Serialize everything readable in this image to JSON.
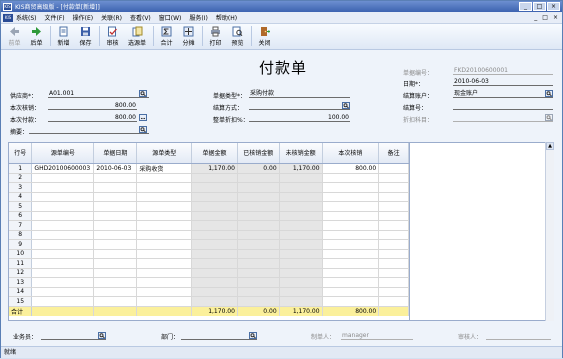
{
  "window": {
    "title": "KIS商贸高级版 - [付款单[新增]]",
    "logo_text": "KIS",
    "controls": [
      "_",
      "□",
      "×"
    ]
  },
  "menu": {
    "items": [
      "系统(S)",
      "文件(F)",
      "操作(E)",
      "关联(R)",
      "查看(V)",
      "窗口(W)",
      "服务(I)",
      "帮助(H)"
    ],
    "right_controls": [
      "_",
      "□",
      "×"
    ]
  },
  "toolbar": {
    "items": [
      {
        "label": "前单",
        "icon": "back-arrow-icon",
        "enabled": false
      },
      {
        "label": "后单",
        "icon": "forward-arrow-icon",
        "enabled": true
      },
      {
        "label": "新增",
        "icon": "new-doc-icon",
        "enabled": true
      },
      {
        "label": "保存",
        "icon": "save-icon",
        "enabled": true
      },
      {
        "label": "审核",
        "icon": "audit-icon",
        "enabled": true
      },
      {
        "label": "选源单",
        "icon": "select-source-icon",
        "enabled": true
      },
      {
        "label": "合计",
        "icon": "total-icon",
        "enabled": true
      },
      {
        "label": "分摊",
        "icon": "allocate-icon",
        "enabled": true
      },
      {
        "label": "打印",
        "icon": "print-icon",
        "enabled": true
      },
      {
        "label": "预览",
        "icon": "preview-icon",
        "enabled": true
      },
      {
        "label": "关闭",
        "icon": "close-door-icon",
        "enabled": true
      }
    ]
  },
  "form": {
    "title": "付款单",
    "doc_no_label": "单据编号：",
    "doc_no": "FKD20100600001",
    "date_label": "日期*：",
    "date": "2010-06-03",
    "settle_account_label": "结算账户：",
    "settle_account": "现金账户",
    "settle_no_label": "结算号：",
    "settle_no": "",
    "discount_account_label": "折扣科目：",
    "discount_account": "",
    "supplier_label": "供应商*：",
    "supplier": "A01.001",
    "current_writeoff_label": "本次核销：",
    "current_writeoff": "800.00",
    "current_payment_label": "本次付款：",
    "current_payment": "800.00",
    "summary_label": "摘要：",
    "summary": "",
    "doc_type_label": "单据类型*：",
    "doc_type": "采购付款",
    "settle_method_label": "结算方式：",
    "settle_method": "",
    "discount_label": "整单折扣%：",
    "discount": "100.00"
  },
  "grid": {
    "headers": [
      "行号",
      "源单编号",
      "单据日期",
      "源单类型",
      "单据金额",
      "已核销金额",
      "未核销金额",
      "本次核销",
      "备注"
    ],
    "rows": [
      {
        "no": "1",
        "source_no": "GHD20100600003",
        "date": "2010-06-03",
        "type": "采购收货",
        "amount": "1,170.00",
        "written_off": "0.00",
        "unwritten": "1,170.00",
        "current": "800.00",
        "remark": ""
      },
      {
        "no": "2",
        "source_no": "",
        "date": "",
        "type": "",
        "amount": "",
        "written_off": "",
        "unwritten": "",
        "current": "",
        "remark": ""
      },
      {
        "no": "3",
        "source_no": "",
        "date": "",
        "type": "",
        "amount": "",
        "written_off": "",
        "unwritten": "",
        "current": "",
        "remark": ""
      },
      {
        "no": "4",
        "source_no": "",
        "date": "",
        "type": "",
        "amount": "",
        "written_off": "",
        "unwritten": "",
        "current": "",
        "remark": ""
      },
      {
        "no": "5",
        "source_no": "",
        "date": "",
        "type": "",
        "amount": "",
        "written_off": "",
        "unwritten": "",
        "current": "",
        "remark": ""
      },
      {
        "no": "6",
        "source_no": "",
        "date": "",
        "type": "",
        "amount": "",
        "written_off": "",
        "unwritten": "",
        "current": "",
        "remark": ""
      },
      {
        "no": "7",
        "source_no": "",
        "date": "",
        "type": "",
        "amount": "",
        "written_off": "",
        "unwritten": "",
        "current": "",
        "remark": ""
      },
      {
        "no": "8",
        "source_no": "",
        "date": "",
        "type": "",
        "amount": "",
        "written_off": "",
        "unwritten": "",
        "current": "",
        "remark": ""
      },
      {
        "no": "9",
        "source_no": "",
        "date": "",
        "type": "",
        "amount": "",
        "written_off": "",
        "unwritten": "",
        "current": "",
        "remark": ""
      },
      {
        "no": "10",
        "source_no": "",
        "date": "",
        "type": "",
        "amount": "",
        "written_off": "",
        "unwritten": "",
        "current": "",
        "remark": ""
      },
      {
        "no": "11",
        "source_no": "",
        "date": "",
        "type": "",
        "amount": "",
        "written_off": "",
        "unwritten": "",
        "current": "",
        "remark": ""
      },
      {
        "no": "12",
        "source_no": "",
        "date": "",
        "type": "",
        "amount": "",
        "written_off": "",
        "unwritten": "",
        "current": "",
        "remark": ""
      },
      {
        "no": "13",
        "source_no": "",
        "date": "",
        "type": "",
        "amount": "",
        "written_off": "",
        "unwritten": "",
        "current": "",
        "remark": ""
      },
      {
        "no": "14",
        "source_no": "",
        "date": "",
        "type": "",
        "amount": "",
        "written_off": "",
        "unwritten": "",
        "current": "",
        "remark": ""
      },
      {
        "no": "15",
        "source_no": "",
        "date": "",
        "type": "",
        "amount": "",
        "written_off": "",
        "unwritten": "",
        "current": "",
        "remark": ""
      }
    ],
    "total": {
      "label": "合计",
      "amount": "1,170.00",
      "written_off": "0.00",
      "unwritten": "1,170.00",
      "current": "800.00"
    }
  },
  "footer": {
    "clerk_label": "业务员：",
    "clerk": "",
    "dept_label": "部门：",
    "dept": "",
    "maker_label": "制单人：",
    "maker": "manager",
    "auditor_label": "审核人：",
    "auditor": ""
  },
  "status": {
    "text": "就绪"
  },
  "colors": {
    "total_row": "#fbf09b",
    "title_bar": "#3d63b0",
    "window_bg": "#eef3fa"
  }
}
